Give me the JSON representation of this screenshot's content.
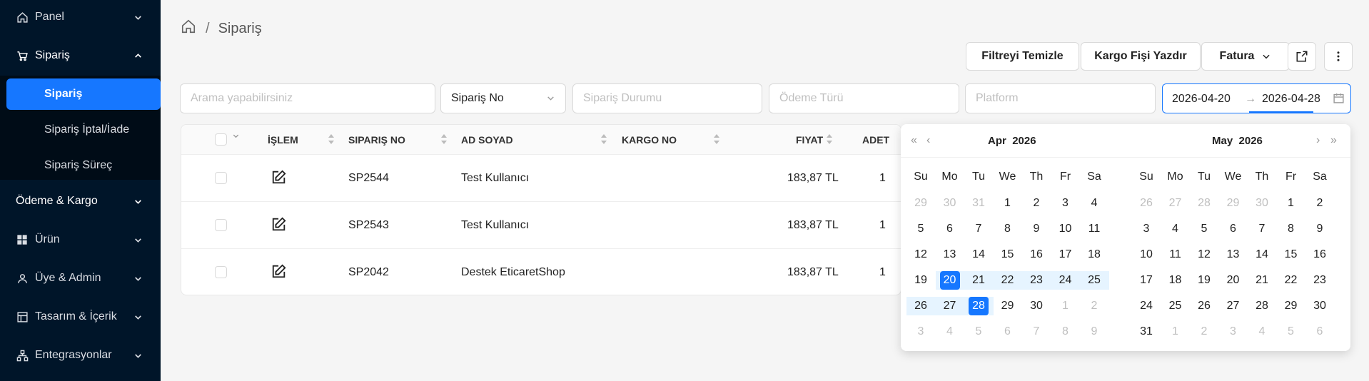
{
  "sidebar": {
    "items": [
      {
        "label": "Panel",
        "icon": "home-icon"
      },
      {
        "label": "Sipariş",
        "icon": "cart-icon"
      },
      {
        "label": "Ödeme & Kargo"
      },
      {
        "label": "Ürün",
        "icon": "grid-icon"
      },
      {
        "label": "Üye & Admin",
        "icon": "user-icon"
      },
      {
        "label": "Tasarım & İçerik",
        "icon": "layout-icon"
      },
      {
        "label": "Entegrasyonlar",
        "icon": "network-icon"
      }
    ],
    "subitems": [
      {
        "label": "Sipariş",
        "active": true
      },
      {
        "label": "Sipariş İptal/İade"
      },
      {
        "label": "Sipariş Süreç"
      }
    ]
  },
  "breadcrumb": {
    "current": "Sipariş",
    "separator": "/"
  },
  "toolbar": {
    "clear_filter": "Filtreyi Temizle",
    "print_cargo": "Kargo Fişi Yazdır",
    "invoice": "Fatura"
  },
  "filters": {
    "search_placeholder": "Arama yapabilirsiniz",
    "search_field": "Sipariş No",
    "status_placeholder": "Sipariş Durumu",
    "payment_placeholder": "Ödeme Türü",
    "platform_placeholder": "Platform",
    "date_from": "2026-04-20",
    "date_to": "2026-04-28"
  },
  "table": {
    "columns": [
      "İŞLEM",
      "SIPARIŞ NO",
      "AD SOYAD",
      "KARGO NO",
      "FIYAT",
      "ADET"
    ],
    "rows": [
      {
        "order_no": "SP2544",
        "name": "Test Kullanıcı",
        "cargo": "",
        "price": "183,87 TL",
        "qty": "1"
      },
      {
        "order_no": "SP2543",
        "name": "Test Kullanıcı",
        "cargo": "",
        "price": "183,87 TL",
        "qty": "1"
      },
      {
        "order_no": "SP2042",
        "name": "Destek EticaretShop",
        "cargo": "",
        "price": "183,87 TL",
        "qty": "1"
      }
    ]
  },
  "calendar": {
    "left": {
      "month": "Apr",
      "year": "2026"
    },
    "right": {
      "month": "May",
      "year": "2026"
    },
    "weekdays": [
      "Su",
      "Mo",
      "Tu",
      "We",
      "Th",
      "Fr",
      "Sa"
    ],
    "left_days": [
      [
        "29",
        "30",
        "31",
        "1",
        "2",
        "3",
        "4"
      ],
      [
        "5",
        "6",
        "7",
        "8",
        "9",
        "10",
        "11"
      ],
      [
        "12",
        "13",
        "14",
        "15",
        "16",
        "17",
        "18"
      ],
      [
        "19",
        "20",
        "21",
        "22",
        "23",
        "24",
        "25"
      ],
      [
        "26",
        "27",
        "28",
        "29",
        "30",
        "1",
        "2"
      ],
      [
        "3",
        "4",
        "5",
        "6",
        "7",
        "8",
        "9"
      ]
    ],
    "right_days": [
      [
        "26",
        "27",
        "28",
        "29",
        "30",
        "1",
        "2"
      ],
      [
        "3",
        "4",
        "5",
        "6",
        "7",
        "8",
        "9"
      ],
      [
        "10",
        "11",
        "12",
        "13",
        "14",
        "15",
        "16"
      ],
      [
        "17",
        "18",
        "19",
        "20",
        "21",
        "22",
        "23"
      ],
      [
        "24",
        "25",
        "26",
        "27",
        "28",
        "29",
        "30"
      ],
      [
        "31",
        "1",
        "2",
        "3",
        "4",
        "5",
        "6"
      ]
    ],
    "accent": "#1677ff",
    "range_color": "#e6f4ff"
  }
}
